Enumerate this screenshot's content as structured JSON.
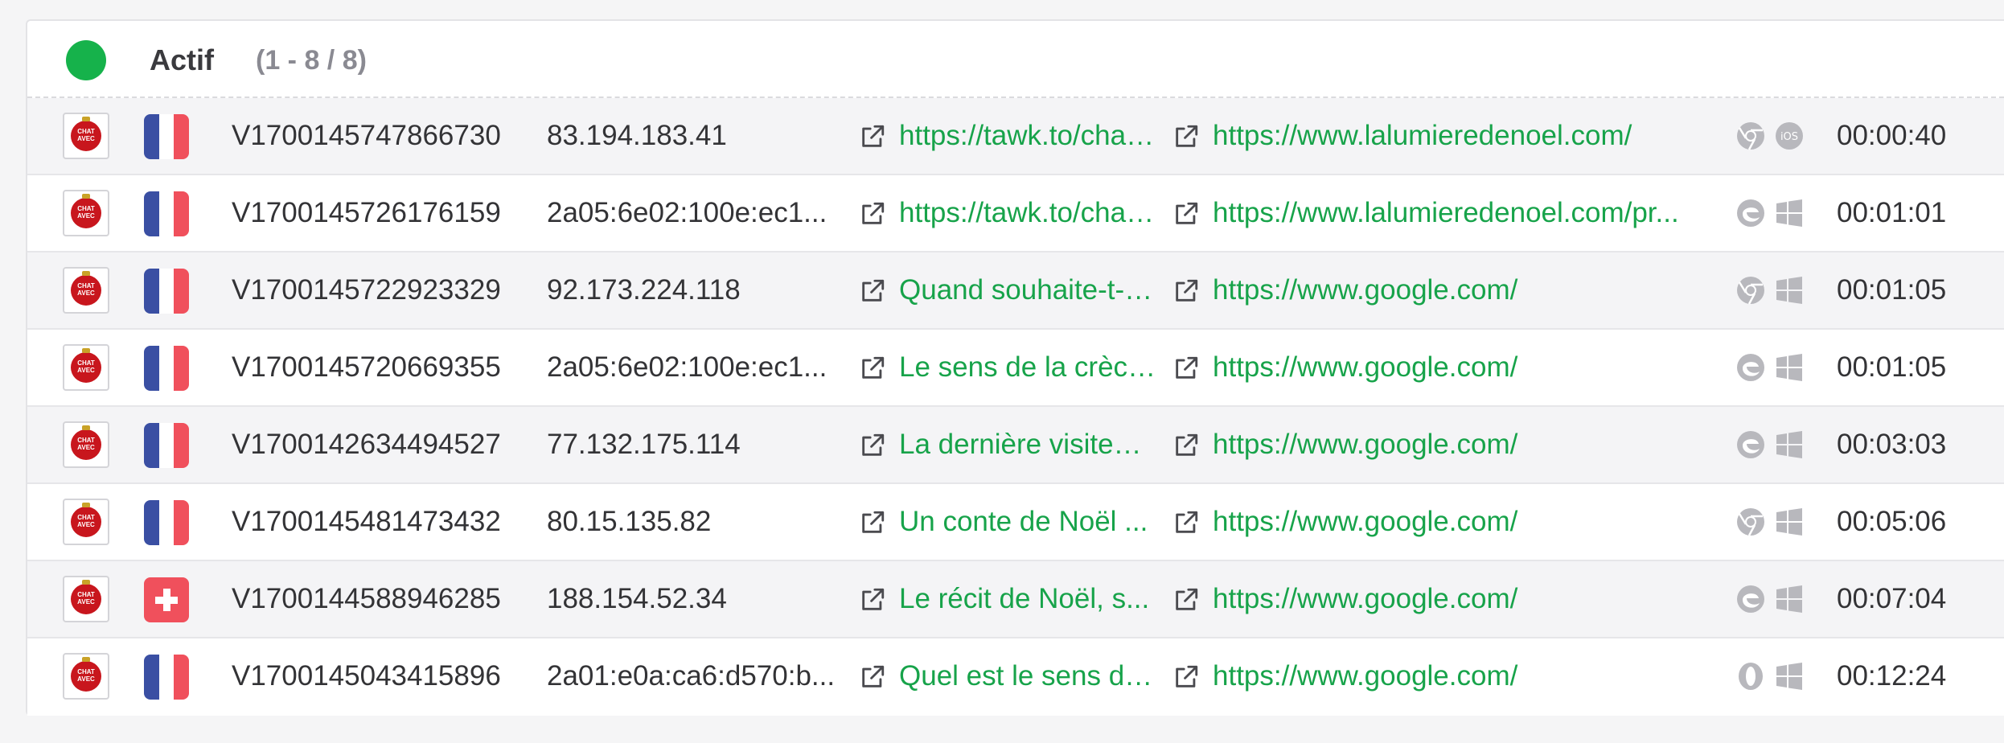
{
  "header": {
    "status_color": "#16b24b",
    "title": "Actif",
    "count": "(1 - 8 / 8)"
  },
  "rows": [
    {
      "flag": "fr",
      "visitor_id": "V1700145747866730",
      "ip": "83.194.183.41",
      "page": "https://tawk.to/chat/...",
      "referrer": "https://www.lalumieredenoel.com/",
      "browser": "chrome",
      "os": "ios",
      "time": "00:00:40"
    },
    {
      "flag": "fr",
      "visitor_id": "V1700145726176159",
      "ip": "2a05:6e02:100e:ec1...",
      "page": "https://tawk.to/chat/...",
      "referrer": "https://www.lalumieredenoel.com/pr...",
      "browser": "edge",
      "os": "windows",
      "time": "00:01:01"
    },
    {
      "flag": "fr",
      "visitor_id": "V1700145722923329",
      "ip": "92.173.224.118",
      "page": "Quand souhaite-t-on...",
      "referrer": "https://www.google.com/",
      "browser": "chrome",
      "os": "windows",
      "time": "00:01:05"
    },
    {
      "flag": "fr",
      "visitor_id": "V1700145720669355",
      "ip": "2a05:6e02:100e:ec1...",
      "page": "Le sens de la crèche...",
      "referrer": "https://www.google.com/",
      "browser": "edge",
      "os": "windows",
      "time": "00:01:05"
    },
    {
      "flag": "fr",
      "visitor_id": "V1700142634494527",
      "ip": "77.132.175.114",
      "page": "La dernière visiteuse...",
      "referrer": "https://www.google.com/",
      "browser": "edge",
      "os": "windows",
      "time": "00:03:03"
    },
    {
      "flag": "fr",
      "visitor_id": "V1700145481473432",
      "ip": "80.15.135.82",
      "page": "Un conte de Noël ...",
      "referrer": "https://www.google.com/",
      "browser": "chrome",
      "os": "windows",
      "time": "00:05:06"
    },
    {
      "flag": "ch",
      "visitor_id": "V1700144588946285",
      "ip": "188.154.52.34",
      "page": "Le récit de Noël, s...",
      "referrer": "https://www.google.com/",
      "browser": "edge",
      "os": "windows",
      "time": "00:07:04"
    },
    {
      "flag": "fr",
      "visitor_id": "V1700145043415896",
      "ip": "2a01:e0a:ca6:d570:b...",
      "page": "Quel est le sens de...",
      "referrer": "https://www.google.com/",
      "browser": "opera",
      "os": "windows",
      "time": "00:12:24"
    }
  ],
  "avatar_text": "CHAT AVEC NOUS",
  "colors": {
    "link": "#17a34a",
    "flag_blue": "#3a4fa3",
    "flag_red": "#f0505c",
    "icon_gray": "#b8b8bd"
  }
}
